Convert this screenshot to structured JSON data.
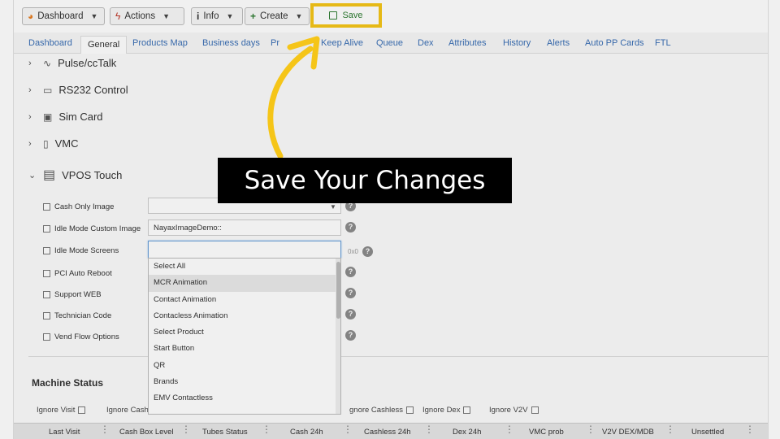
{
  "toolbar": {
    "dashboard": "Dashboard",
    "actions": "Actions",
    "info": "Info",
    "create": "Create",
    "save": "Save"
  },
  "tabs": [
    "Dashboard",
    "General",
    "Products Map",
    "Business days",
    "Pr",
    "Keep Alive",
    "Queue",
    "Dex",
    "Attributes",
    "History",
    "Alerts",
    "Auto PP Cards",
    "FTL"
  ],
  "sections": {
    "pulse": "Pulse/ccTalk",
    "rs232": "RS232 Control",
    "sim": "Sim Card",
    "vmc": "VMC",
    "vpos": "VPOS Touch"
  },
  "settings": {
    "cash_only_image": "Cash Only Image",
    "idle_custom": "Idle Mode Custom Image",
    "idle_custom_value": "NayaxImageDemo::",
    "idle_screens": "Idle Mode Screens",
    "idle_screens_value": "0x0",
    "pci_auto_reboot": "PCI Auto Reboot",
    "support_web": "Support WEB",
    "technician_code": "Technician Code",
    "vend_flow": "Vend Flow Options"
  },
  "dropdown_options": [
    "Select All",
    "MCR Animation",
    "Contact Animation",
    "Contacless Animation",
    "Select Product",
    "Start Button",
    "QR",
    "Brands",
    "EMV Contactless"
  ],
  "machine_status": {
    "title": "Machine Status",
    "ignore_visit": "Ignore Visit",
    "ignore_cash": "Ignore Cash",
    "ignore_cashless": "gnore Cashless",
    "ignore_dex": "Ignore Dex",
    "ignore_v2v": "Ignore V2V"
  },
  "columns": [
    "Last Visit",
    "Cash Box Level",
    "Tubes Status",
    "Cash 24h",
    "Cashless 24h",
    "Dex 24h",
    "VMC prob",
    "V2V DEX/MDB",
    "Unsettled"
  ],
  "callout": "Save Your Changes",
  "colors": {
    "highlight": "#f5c518",
    "link": "#3a6fb5",
    "save_green": "#2e7d32"
  }
}
